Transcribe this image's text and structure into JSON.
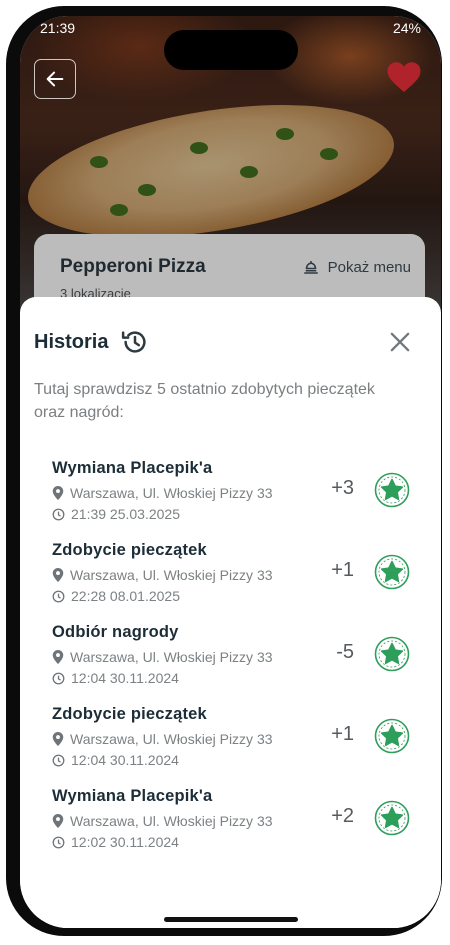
{
  "status_bar": {
    "time": "21:39",
    "battery": "24%"
  },
  "restaurant": {
    "name": "Pepperoni Pizza",
    "locations": "3 lokalizacje",
    "menu_label": "Pokaż menu"
  },
  "history": {
    "title": "Historia",
    "description": "Tutaj sprawdzisz 5 ostatnio zdobytych pieczątek oraz nagród:",
    "items": [
      {
        "title": "Wymiana Placepik'a",
        "address": "Warszawa, Ul. Włoskiej Pizzy 33",
        "datetime": "21:39 25.03.2025",
        "amount": "+3"
      },
      {
        "title": "Zdobycie pieczątek",
        "address": "Warszawa, Ul. Włoskiej Pizzy 33",
        "datetime": "22:28 08.01.2025",
        "amount": "+1"
      },
      {
        "title": "Odbiór nagrody",
        "address": "Warszawa, Ul. Włoskiej Pizzy 33",
        "datetime": "12:04 30.11.2024",
        "amount": "-5"
      },
      {
        "title": "Zdobycie pieczątek",
        "address": "Warszawa, Ul. Włoskiej Pizzy 33",
        "datetime": "12:04 30.11.2024",
        "amount": "+1"
      },
      {
        "title": "Wymiana Placepik'a",
        "address": "Warszawa, Ul. Włoskiej Pizzy 33",
        "datetime": "12:02 30.11.2024",
        "amount": "+2"
      }
    ]
  },
  "icons": {
    "back": "arrow-left-icon",
    "favorite": "heart-icon",
    "menu": "menu-icon",
    "history": "history-icon",
    "close": "close-icon",
    "location": "location-pin-icon",
    "time": "clock-icon",
    "stamp": "star-stamp-icon"
  },
  "colors": {
    "accent_green": "#2e9e5b",
    "heart_red": "#b1232a",
    "title_dark": "#1c2d37"
  }
}
